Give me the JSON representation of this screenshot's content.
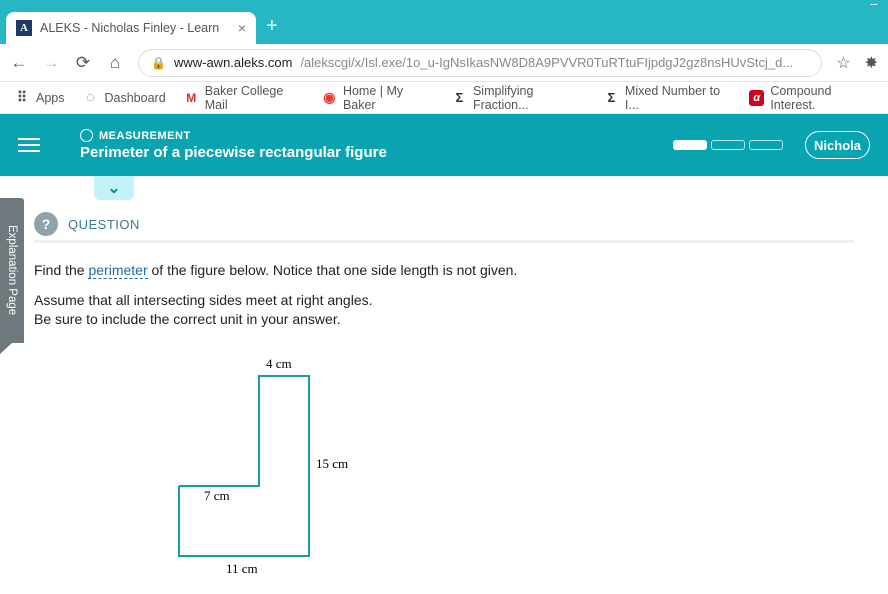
{
  "window": {
    "tab_title": "ALEKS - Nicholas Finley - Learn"
  },
  "browser": {
    "url_host": "www-awn.aleks.com",
    "url_path": "/alekscgi/x/Isl.exe/1o_u-IgNsIkasNW8D8A9PVVR0TuRTtuFIjpdgJ2gz8nsHUvStcj_d...",
    "bookmarks": {
      "apps": "Apps",
      "dashboard": "Dashboard",
      "baker_mail": "Baker College Mail",
      "home_baker": "Home | My Baker",
      "simplifying": "Simplifying Fraction...",
      "mixed_num": "Mixed Number to I...",
      "compound": "Compound Interest."
    }
  },
  "header": {
    "category": "MEASUREMENT",
    "topic": "Perimeter of a piecewise rectangular figure",
    "user": "Nichola"
  },
  "sidetab": {
    "label": "Explanation Page"
  },
  "question": {
    "heading": "QUESTION",
    "line1_pre": "Find the ",
    "perimeter_word": "perimeter",
    "line1_post": " of the figure below. Notice that one side length is not given.",
    "line2": "Assume that all intersecting sides meet at right angles.",
    "line3": "Be sure to include the correct unit in your answer."
  },
  "figure": {
    "top_label": "4 cm",
    "right_label": "15 cm",
    "left_label": "7 cm",
    "bottom_label": "11 cm"
  }
}
